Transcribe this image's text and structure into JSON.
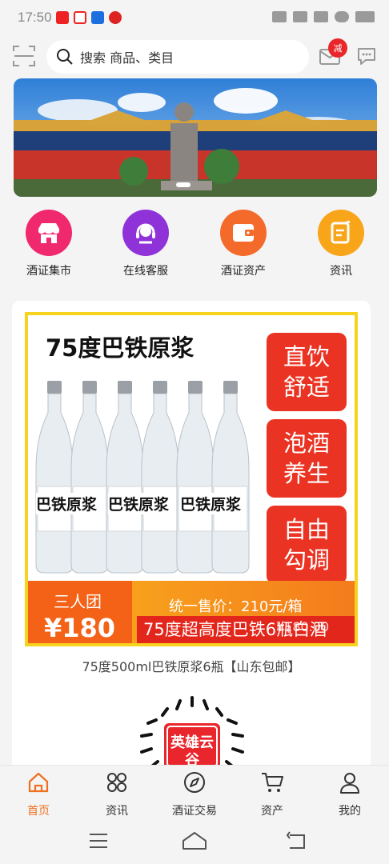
{
  "status": {
    "time": "17:50"
  },
  "header": {
    "search_placeholder": "搜索 商品、类目",
    "mail_badge": "减"
  },
  "quick_nav": [
    {
      "label": "酒证集市",
      "icon": "store-icon",
      "color": "#f0286e"
    },
    {
      "label": "在线客服",
      "icon": "headset-icon",
      "color": "#8f33d9"
    },
    {
      "label": "酒证资产",
      "icon": "wallet-icon",
      "color": "#f46a2a"
    },
    {
      "label": "资讯",
      "icon": "note-icon",
      "color": "#f9a51a"
    }
  ],
  "product": {
    "headline": "75度巴铁原浆",
    "tags": [
      "直饮舒适",
      "泡酒养生",
      "自由勾调"
    ],
    "tag_lines": [
      [
        "直饮",
        "舒适"
      ],
      [
        "泡酒",
        "养生"
      ],
      [
        "自由",
        "勾调"
      ]
    ],
    "bottle_label": "巴铁原浆",
    "group_label": "三人团",
    "group_price": "¥180",
    "unified_price": "统一售价：210元/箱",
    "ribbon_text": "75度超高度巴铁6瓶白酒",
    "ghost_price": "¥180.00",
    "name": "75度500ml巴铁原浆6瓶【山东包邮】",
    "logo_text": "英雄云谷"
  },
  "tabs": [
    {
      "label": "首页",
      "icon": "home-icon",
      "active": true
    },
    {
      "label": "资讯",
      "icon": "grid-icon",
      "active": false
    },
    {
      "label": "酒证交易",
      "icon": "compass-icon",
      "active": false
    },
    {
      "label": "资产",
      "icon": "cart-icon",
      "active": false
    },
    {
      "label": "我的",
      "icon": "user-icon",
      "active": false
    }
  ],
  "colors": {
    "accent": "#f07020",
    "brand_red": "#ea3323",
    "gold": "#f7d21e"
  }
}
